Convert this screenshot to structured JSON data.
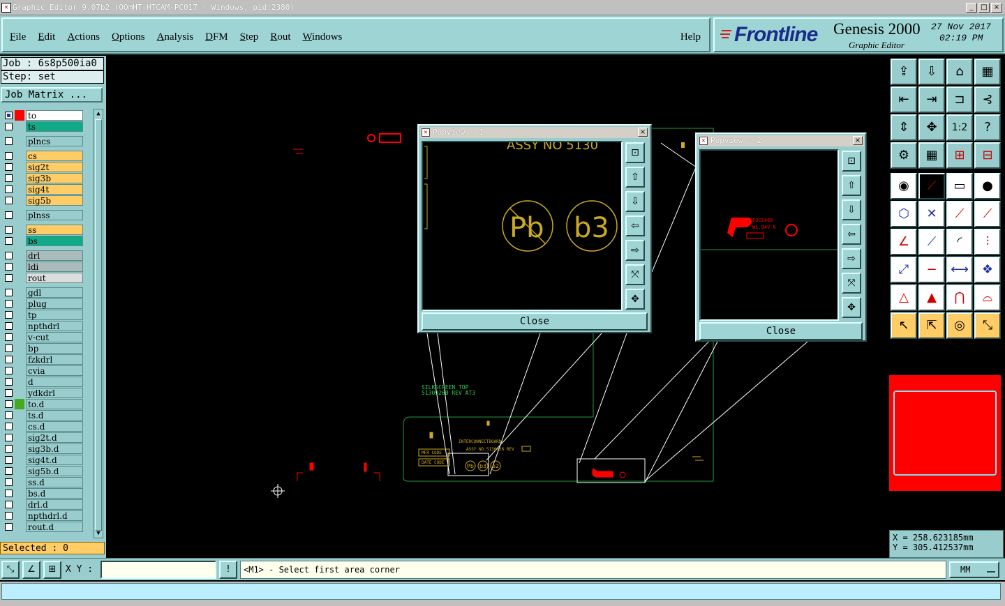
{
  "window": {
    "title": "Graphic Editor 9.07b2 (OO@HT-HTCAM-PC017 - Windows, pid:2380)",
    "minimize": "_",
    "maximize": "□",
    "close": "×"
  },
  "menu": {
    "items": [
      "File",
      "Edit",
      "Actions",
      "Options",
      "Analysis",
      "DFM",
      "Step",
      "Rout",
      "Windows"
    ],
    "help": "Help"
  },
  "brand": {
    "logo": "Frontline",
    "product": "Genesis 2000",
    "subtitle": "Graphic Editor",
    "date": "27 Nov 2017",
    "time": "02:19 PM"
  },
  "left": {
    "job": "Job : 6s8p500ia0",
    "step": "Step: set",
    "job_matrix": "Job Matrix ...",
    "selected": "Selected : 0",
    "layers": [
      {
        "name": "to",
        "color": "#ffffff",
        "swatch": "#ff0000",
        "group": 0
      },
      {
        "name": "ts",
        "color": "#11aa88",
        "swatch": "",
        "group": 0
      },
      {
        "name": "plncs",
        "color": "#99cccc",
        "swatch": "",
        "group": 1
      },
      {
        "name": "cs",
        "color": "#ffcc66",
        "swatch": "",
        "group": 2
      },
      {
        "name": "sig2t",
        "color": "#ffcc66",
        "swatch": "",
        "group": 2
      },
      {
        "name": "sig3b",
        "color": "#ffcc66",
        "swatch": "",
        "group": 2
      },
      {
        "name": "sig4t",
        "color": "#ffcc66",
        "swatch": "",
        "group": 2
      },
      {
        "name": "sig5b",
        "color": "#ffcc66",
        "swatch": "",
        "group": 2
      },
      {
        "name": "plnss",
        "color": "#99cccc",
        "swatch": "",
        "group": 3
      },
      {
        "name": "ss",
        "color": "#ffcc66",
        "swatch": "",
        "group": 4
      },
      {
        "name": "bs",
        "color": "#11aa88",
        "swatch": "",
        "group": 4
      },
      {
        "name": "drl",
        "color": "#aabbbb",
        "swatch": "",
        "group": 5
      },
      {
        "name": "ldi",
        "color": "#aabbbb",
        "swatch": "",
        "group": 5
      },
      {
        "name": "rout",
        "color": "#dddddd",
        "swatch": "",
        "group": 5
      },
      {
        "name": "gdl",
        "color": "#99cccc",
        "swatch": "",
        "group": 6
      },
      {
        "name": "plug",
        "color": "#99cccc",
        "swatch": "",
        "group": 6
      },
      {
        "name": "tp",
        "color": "#99cccc",
        "swatch": "",
        "group": 6
      },
      {
        "name": "npthdrl",
        "color": "#99cccc",
        "swatch": "",
        "group": 6
      },
      {
        "name": "v-cut",
        "color": "#99cccc",
        "swatch": "",
        "group": 6
      },
      {
        "name": "bp",
        "color": "#99cccc",
        "swatch": "",
        "group": 6
      },
      {
        "name": "fzkdrl",
        "color": "#99cccc",
        "swatch": "",
        "group": 6
      },
      {
        "name": "cvia",
        "color": "#99cccc",
        "swatch": "",
        "group": 6
      },
      {
        "name": "d",
        "color": "#99cccc",
        "swatch": "",
        "group": 6
      },
      {
        "name": "ydkdrl",
        "color": "#99cccc",
        "swatch": "",
        "group": 6
      },
      {
        "name": "to.d",
        "color": "#99cccc",
        "swatch": "#44aa22",
        "group": 6
      },
      {
        "name": "ts.d",
        "color": "#99cccc",
        "swatch": "",
        "group": 6
      },
      {
        "name": "cs.d",
        "color": "#99cccc",
        "swatch": "",
        "group": 6
      },
      {
        "name": "sig2t.d",
        "color": "#99cccc",
        "swatch": "",
        "group": 6
      },
      {
        "name": "sig3b.d",
        "color": "#99cccc",
        "swatch": "",
        "group": 6
      },
      {
        "name": "sig4t.d",
        "color": "#99cccc",
        "swatch": "",
        "group": 6
      },
      {
        "name": "sig5b.d",
        "color": "#99cccc",
        "swatch": "",
        "group": 6
      },
      {
        "name": "ss.d",
        "color": "#99cccc",
        "swatch": "",
        "group": 6
      },
      {
        "name": "bs.d",
        "color": "#99cccc",
        "swatch": "",
        "group": 6
      },
      {
        "name": "drl.d",
        "color": "#99cccc",
        "swatch": "",
        "group": 6
      },
      {
        "name": "npthdrl.d",
        "color": "#99cccc",
        "swatch": "",
        "group": 6
      },
      {
        "name": "rout.d",
        "color": "#99cccc",
        "swatch": "",
        "group": 6
      }
    ]
  },
  "canvas": {
    "silkscreen_label_1": "SILKSCREEN TOP",
    "silkscreen_label_2": "5130926B REV AT3",
    "board_text_1": "INTERCONNECTBOARD",
    "board_text_2": "ASSY NO.5130926 REV",
    "board_text_3": "MFR CODE",
    "board_text_4": "DATE CODE",
    "mark_pb": "Pb",
    "mark_b3": "b3",
    "mark_e2": "e2"
  },
  "popview1": {
    "title": "Popview - 1",
    "close_label": "Close",
    "partial_text": "ASSY NO 5130",
    "mark_pb": "Pb",
    "mark_b3": "b3"
  },
  "popview2": {
    "title": "Popview - 2",
    "close_label": "Close",
    "text_1": "F3C1460",
    "text_2": "W1.94V-0"
  },
  "right": {
    "coord_x": "X = 258.623185mm",
    "coord_y": "Y = 305.412537mm"
  },
  "bottom": {
    "xy_label": "X Y :",
    "xy_value": "",
    "prompt": "<M1> - Select first area corner",
    "units": "MM"
  },
  "colors": {
    "panel": "#99cccc",
    "canvas": "#000000",
    "selection": "#ff0000",
    "gold": "#ffcc66",
    "green": "#11aa88"
  }
}
